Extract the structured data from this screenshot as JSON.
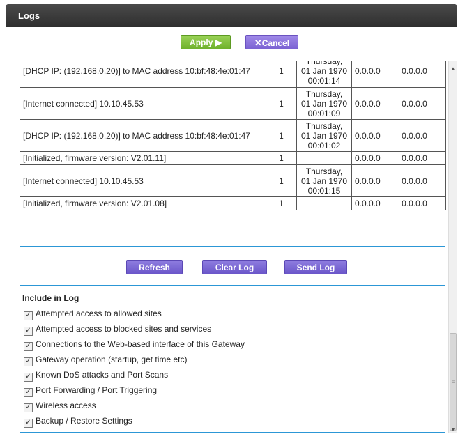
{
  "window": {
    "title": "Logs"
  },
  "actions": {
    "apply_label": "Apply ▶",
    "cancel_label": "Cancel",
    "cancel_icon": "x-icon"
  },
  "log_rows": [
    {
      "message": "[DHCP IP: (192.168.0.20)] to MAC address 10:bf:48:4e:01:47",
      "count": "1",
      "time": [
        "Thursday,",
        "01 Jan 1970",
        "00:01:14"
      ],
      "src": "0.0.0.0",
      "dst": "0.0.0.0"
    },
    {
      "message": "[Internet connected] 10.10.45.53",
      "count": "1",
      "time": [
        "Thursday,",
        "01 Jan 1970",
        "00:01:09"
      ],
      "src": "0.0.0.0",
      "dst": "0.0.0.0"
    },
    {
      "message": "[DHCP IP: (192.168.0.20)] to MAC address 10:bf:48:4e:01:47",
      "count": "1",
      "time": [
        "Thursday,",
        "01 Jan 1970",
        "00:01:02"
      ],
      "src": "0.0.0.0",
      "dst": "0.0.0.0"
    },
    {
      "message": "[Initialized, firmware version: V2.01.11]",
      "count": "1",
      "time": [],
      "src": "0.0.0.0",
      "dst": "0.0.0.0"
    },
    {
      "message": "[Internet connected] 10.10.45.53",
      "count": "1",
      "time": [
        "Thursday,",
        "01 Jan 1970",
        "00:01:15"
      ],
      "src": "0.0.0.0",
      "dst": "0.0.0.0"
    },
    {
      "message": "[Initialized, firmware version: V2.01.08]",
      "count": "1",
      "time": [],
      "src": "0.0.0.0",
      "dst": "0.0.0.0"
    }
  ],
  "log_buttons": {
    "refresh": "Refresh",
    "clear": "Clear Log",
    "send": "Send Log"
  },
  "include": {
    "title": "Include in Log",
    "options": [
      {
        "label": "Attempted access to allowed sites",
        "checked": true
      },
      {
        "label": "Attempted access to blocked sites and services",
        "checked": true
      },
      {
        "label": "Connections to the Web-based interface of this Gateway",
        "checked": true
      },
      {
        "label": "Gateway operation (startup, get time etc)",
        "checked": true
      },
      {
        "label": "Known DoS attacks and Port Scans",
        "checked": true
      },
      {
        "label": "Port Forwarding / Port Triggering",
        "checked": true
      },
      {
        "label": "Wireless access",
        "checked": true
      },
      {
        "label": "Backup / Restore Settings",
        "checked": true
      }
    ]
  },
  "colors": {
    "accent": "#2c97d6",
    "apply": "#7cbf3a",
    "purple": "#7b62d3"
  }
}
